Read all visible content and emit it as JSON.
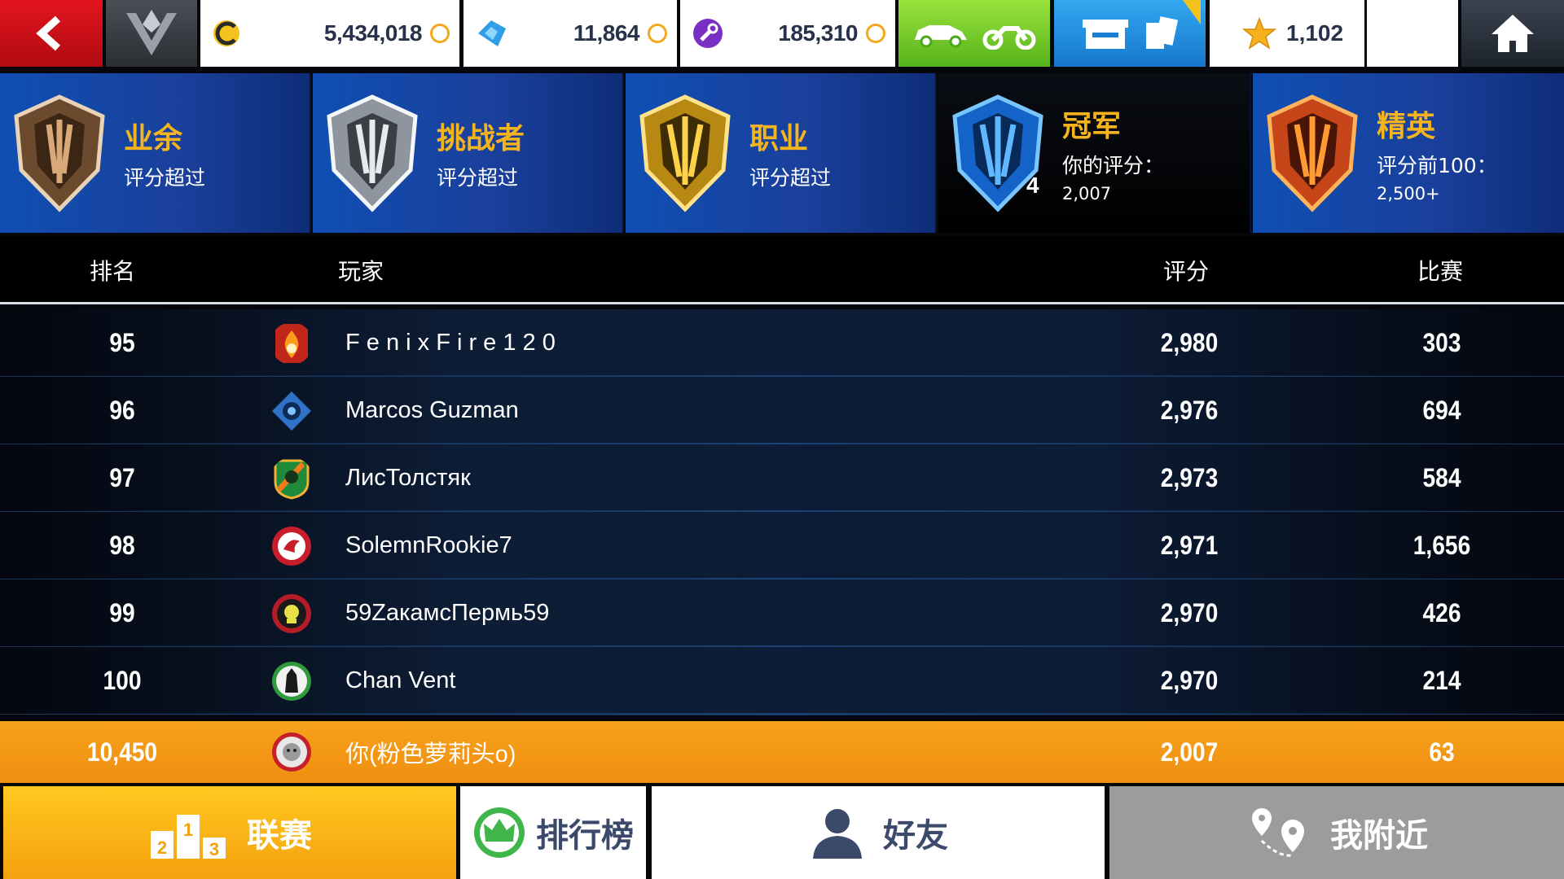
{
  "topbar": {
    "credits": "5,434,018",
    "tokens": "11,864",
    "fusion": "185,310",
    "stars": "1,102"
  },
  "leagues": [
    {
      "name": "业余",
      "sub": "评分超过",
      "detail": ""
    },
    {
      "name": "挑战者",
      "sub": "评分超过",
      "detail": ""
    },
    {
      "name": "职业",
      "sub": "评分超过",
      "detail": ""
    },
    {
      "name": "冠军",
      "sub": "你的评分：",
      "detail": "2,007",
      "tier": "4"
    },
    {
      "name": "精英",
      "sub": "评分前100：",
      "detail": "2,500+"
    }
  ],
  "table": {
    "headers": {
      "rank": "排名",
      "player": "玩家",
      "score": "评分",
      "races": "比赛"
    },
    "rows": [
      {
        "rank": "95",
        "name": "F e n i x F i r e 1 2 0",
        "score": "2,980",
        "races": "303"
      },
      {
        "rank": "96",
        "name": "Marcos Guzman",
        "score": "2,976",
        "races": "694"
      },
      {
        "rank": "97",
        "name": "ЛисТолстяк",
        "score": "2,973",
        "races": "584"
      },
      {
        "rank": "98",
        "name": "SolemnRookie7",
        "score": "2,971",
        "races": "1,656"
      },
      {
        "rank": "99",
        "name": "59ZакамсПермь59",
        "score": "2,970",
        "races": "426"
      },
      {
        "rank": "100",
        "name": "Chan Vent",
        "score": "2,970",
        "races": "214"
      }
    ],
    "me": {
      "rank": "10,450",
      "name": "你(粉色萝莉头o)",
      "score": "2,007",
      "races": "63"
    }
  },
  "bottom_nav": {
    "league": "联赛",
    "ranking": "排行榜",
    "friends": "好友",
    "nearby": "我附近"
  },
  "colors": {
    "back": "#e2141d",
    "accent_orange": "#f5a01a",
    "league_blue": "#1a3f9a",
    "league_name": "#f5b41e"
  },
  "podium": {
    "first": "1",
    "second": "2",
    "third": "3"
  }
}
